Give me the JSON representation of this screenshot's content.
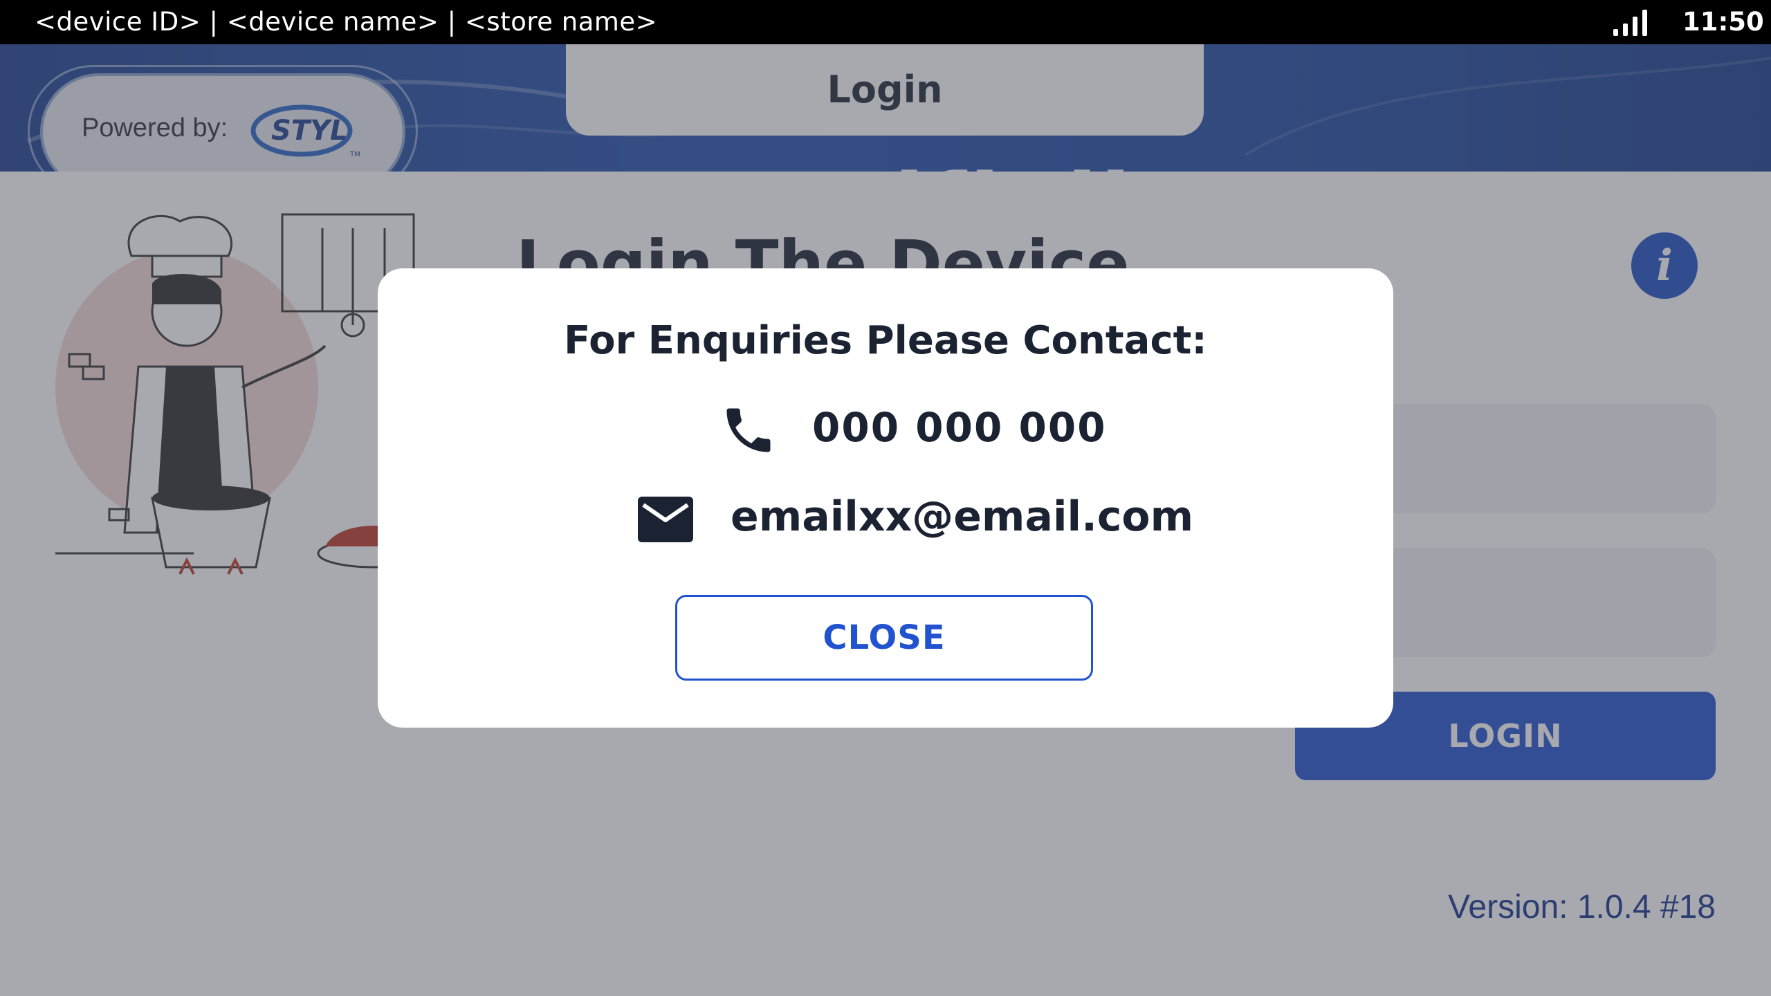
{
  "status_bar": {
    "device_info": "<device ID> | <device name> | <store name>",
    "time": "11:50",
    "signal_icon": "signal-bars-icon"
  },
  "header": {
    "tab_title": "Login",
    "powered_by_label": "Powered by:",
    "styl_logo_text": "STYL",
    "brand_partial": "Easifiell"
  },
  "main": {
    "heading": "Login The Device",
    "info_icon": "info-icon",
    "login_button_label": "LOGIN",
    "version": "Version: 1.0.4 #18"
  },
  "dialog": {
    "title": "For Enquiries Please Contact:",
    "phone": "000 000 000",
    "phone_icon": "phone-icon",
    "email": "emailxx@email.com",
    "email_icon": "email-icon",
    "close_label": "CLOSE"
  },
  "colors": {
    "primary": "#2152cf",
    "header_blue": "#1f4aa3",
    "text_dark": "#1b2232",
    "version_text": "#15308a"
  }
}
